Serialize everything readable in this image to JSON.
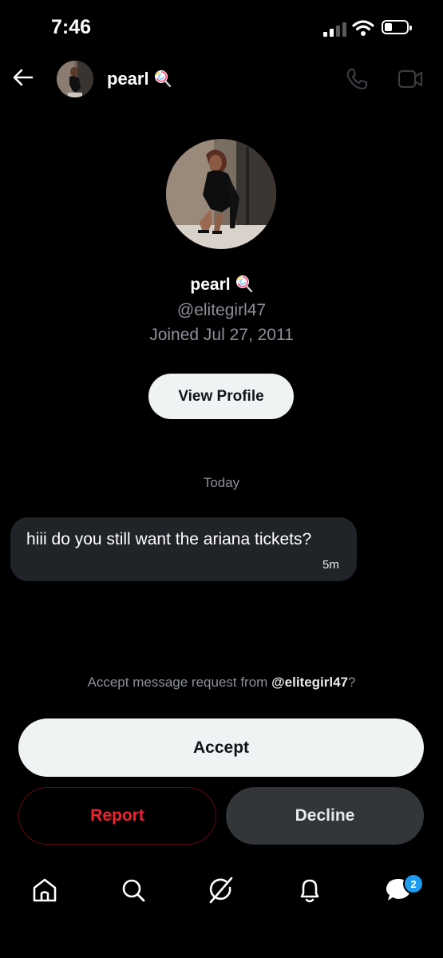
{
  "status_bar": {
    "time": "7:46"
  },
  "header": {
    "name": "pearl"
  },
  "profile": {
    "name": "pearl",
    "handle": "@elitegirl47",
    "joined": "Joined Jul 27, 2011",
    "view_profile_label": "View Profile"
  },
  "conversation": {
    "day_label": "Today",
    "messages": [
      {
        "text": "hiii do you still want the ariana tickets?",
        "time": "5m"
      }
    ]
  },
  "request": {
    "prefix": "Accept message request from ",
    "handle": "@elitegirl47",
    "suffix": "?",
    "accept_label": "Accept",
    "report_label": "Report",
    "decline_label": "Decline"
  },
  "bottom_nav": {
    "items": [
      "home-icon",
      "search-icon",
      "grok-icon",
      "notifications-icon",
      "messages-icon"
    ],
    "messages_badge": "2"
  },
  "colors": {
    "accent": "#1d9bf0",
    "danger": "#f4212e",
    "button_light": "#eff3f4",
    "bubble": "#202327",
    "muted_text": "#8b9099"
  }
}
